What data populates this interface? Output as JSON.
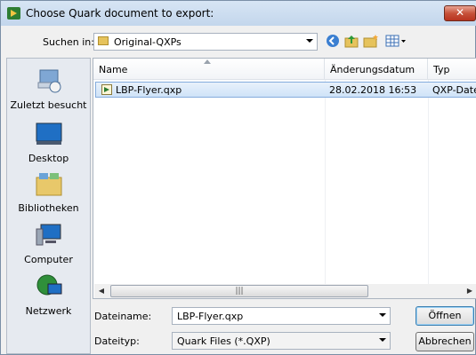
{
  "window": {
    "title": "Choose Quark document to export:",
    "close_label": "✕"
  },
  "toolbar": {
    "look_in_label": "Suchen in:",
    "look_in_value": "Original-QXPs",
    "icons": [
      "back-icon",
      "up-folder-icon",
      "new-folder-icon",
      "view-menu-icon"
    ]
  },
  "places": [
    {
      "label": "Zuletzt besucht",
      "icon": "recent-places-icon"
    },
    {
      "label": "Desktop",
      "icon": "desktop-icon"
    },
    {
      "label": "Bibliotheken",
      "icon": "libraries-icon"
    },
    {
      "label": "Computer",
      "icon": "computer-icon"
    },
    {
      "label": "Netzwerk",
      "icon": "network-icon"
    }
  ],
  "list": {
    "columns": [
      "Name",
      "Änderungsdatum",
      "Typ"
    ],
    "rows": [
      {
        "name": "LBP-Flyer.qxp",
        "date": "28.02.2018 16:53",
        "type": "QXP-Date"
      }
    ]
  },
  "footer": {
    "filename_label": "Dateiname:",
    "filename_value": "LBP-Flyer.qxp",
    "filetype_label": "Dateityp:",
    "filetype_value": "Quark Files (*.QXP)",
    "open_label": "Öffnen",
    "cancel_label": "Abbrechen"
  },
  "colors": {
    "selection": "#cfe3f8",
    "titlebar": "#c3d6ec",
    "close": "#c7523a"
  }
}
